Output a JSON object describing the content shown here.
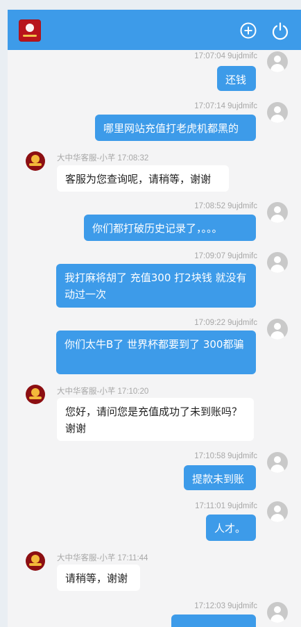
{
  "header": {
    "app_logo": "app-logo",
    "add_icon": "plus-circle-icon",
    "power_icon": "power-icon",
    "colors": {
      "header_bg": "#3d9be9",
      "user_bubble": "#3d9be9"
    }
  },
  "messages": [
    {
      "side": "user",
      "meta": "17:07:04 9ujdmifc",
      "text": "还钱"
    },
    {
      "side": "user",
      "meta": "17:07:14 9ujdmifc",
      "text": "哪里网站充值打老虎机都黑的"
    },
    {
      "side": "agent",
      "meta": "大中华客服-小芊 17:08:32",
      "text": "客服为您查询呢，请稍等，谢谢"
    },
    {
      "side": "user",
      "meta": "17:08:52 9ujdmifc",
      "text": "你们都打破历史记录了，。。。"
    },
    {
      "side": "user",
      "meta": "17:09:07 9ujdmifc",
      "text": "我打麻将胡了 充值300 打2块钱 就没有动过一次"
    },
    {
      "side": "user",
      "meta": "17:09:22 9ujdmifc",
      "text": "你们太牛B了 世界杯都要到了 300都骗"
    },
    {
      "side": "agent",
      "meta": "大中华客服-小芊 17:10:20",
      "text": "您好，请问您是充值成功了未到账吗？谢谢"
    },
    {
      "side": "user",
      "meta": "17:10:58 9ujdmifc",
      "text": "提款未到账"
    },
    {
      "side": "user",
      "meta": "17:11:01 9ujdmifc",
      "text": "人才。"
    },
    {
      "side": "agent",
      "meta": "大中华客服-小芊 17:11:44",
      "text": "请稍等，谢谢"
    },
    {
      "side": "user",
      "meta": "17:12:03 9ujdmifc",
      "text": ""
    }
  ]
}
